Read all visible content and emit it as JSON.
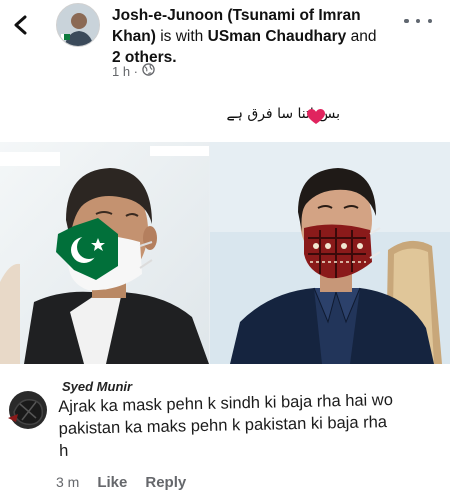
{
  "post": {
    "author": "Josh-e-Junoon (Tsunami of Imran Khan)",
    "with_text": "is with",
    "tagged": "USman Chaudhary",
    "and_text": "and",
    "others": "2 others.",
    "time": "1 h ·",
    "caption": "بس اتنا سا فرق ہے"
  },
  "comment": {
    "author": "Syed Munir",
    "text": "Ajrak ka mask pehn k sindh ki baja rha hai wo pakistan ka maks pehn k pakistan ki baja rha h",
    "time": "3 m",
    "like": "Like",
    "reply": "Reply"
  },
  "colors": {
    "meta": "#65676b",
    "heart": "#e0245e",
    "flag_green": "#01703a",
    "ajrak_red": "#8a1a1a"
  },
  "icons": [
    "back-arrow-icon",
    "globe-icon",
    "more-options-icon",
    "heart-emoji-icon"
  ]
}
